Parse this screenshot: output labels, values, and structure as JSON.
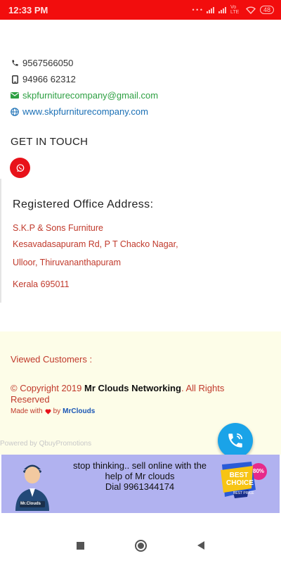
{
  "status_bar": {
    "time": "12:33 PM",
    "network": "Vo LTE",
    "battery": "48"
  },
  "contact": {
    "phone1": "9567566050",
    "phone2": "94966 62312",
    "email": "skpfurniturecompany@gmail.com",
    "website": "www.skpfurniturecompany.com"
  },
  "get_in_touch": "GET IN TOUCH",
  "address": {
    "title": "Registered Office Address:",
    "line1": "S.K.P & Sons Furniture",
    "line2": "Kesavadasapuram Rd, P T Chacko Nagar,",
    "line3": "Ulloor, Thiruvananthapuram",
    "line4": "Kerala 695011"
  },
  "footer": {
    "viewed": "Viewed Customers :",
    "copyright_prefix": "© Copyright 2019 ",
    "copyright_brand": "Mr Clouds Networking",
    "copyright_suffix": ". All Rights Reserved",
    "made_with": "Made with",
    "made_by": "by",
    "made_brand": "MrClouds",
    "powered": "Powered by QbuyPromotions"
  },
  "banner": {
    "line1": "stop thinking.. sell online with the help of Mr clouds",
    "line2": "Dial 9961344174",
    "avatar_label": "Mr.Clouds",
    "badge_main": "BEST CHOICE",
    "badge_sub": "BEST PRICE",
    "badge_pct": "80%"
  },
  "colors": {
    "status_bar": "#f20d0d",
    "accent_red": "#c0392b",
    "email_green": "#2ea043",
    "link_blue": "#1a6fb5",
    "fab_blue": "#1aa3e8",
    "banner_bg": "#b1b2f0",
    "footer_bg": "#fdfde8"
  },
  "icons": [
    "phone-icon",
    "mobile-icon",
    "mail-icon",
    "globe-icon",
    "whatsapp-icon",
    "heart-icon",
    "call-icon"
  ]
}
